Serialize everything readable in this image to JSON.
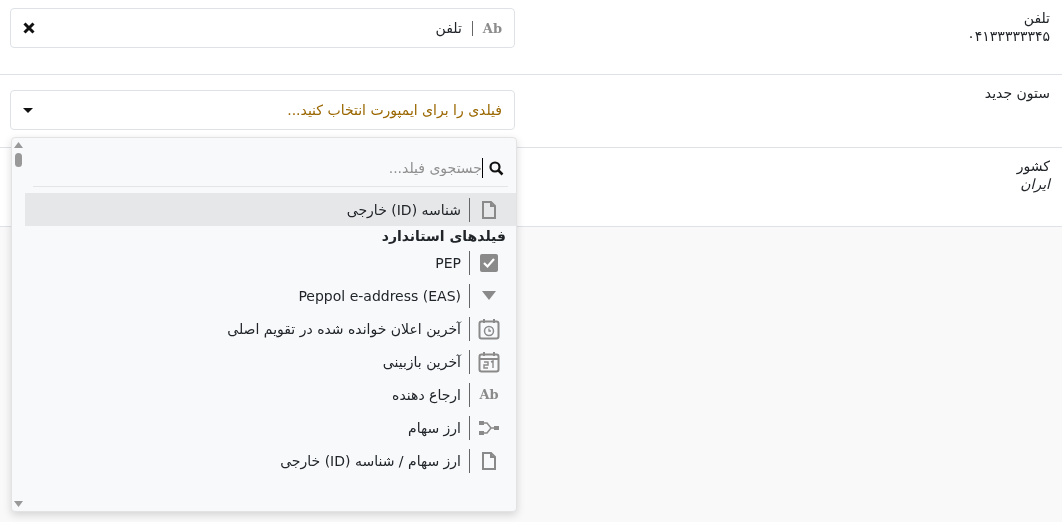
{
  "rows": [
    {
      "label": "تلفن",
      "value": "۰۴۱۳۳۳۳۳۳۴۵",
      "value_italic": false,
      "field": {
        "kind": "chosen",
        "text": "تلفن",
        "type_badge": "Ab"
      }
    },
    {
      "label": "ستون جدید",
      "field": {
        "kind": "empty",
        "placeholder": "فیلدی را برای ایمپورت انتخاب کنید..."
      },
      "dropdown": {
        "search_placeholder": "جستجوی فیلد...",
        "items": [
          {
            "kind": "document",
            "label": "شناسه (ID) خارجی",
            "selected": true
          },
          {
            "kind": "header",
            "label": "فیلدهای استاندارد"
          },
          {
            "kind": "checkbox",
            "label": "PEP",
            "selected": false
          },
          {
            "kind": "selection",
            "label": "Peppol e-address (EAS)",
            "selected": false
          },
          {
            "kind": "datetime",
            "label": "آخرین اعلان خوانده شده در تقویم اصلی",
            "selected": false
          },
          {
            "kind": "date",
            "label": "آخرین بازبینی",
            "selected": false
          },
          {
            "kind": "text",
            "type_badge": "Ab",
            "label": "ارجاع دهنده",
            "selected": false
          },
          {
            "kind": "relation",
            "label": "ارز سهام",
            "selected": false
          },
          {
            "kind": "document",
            "label": "ارز سهام / شناسه (ID) خارجی",
            "selected": false
          }
        ]
      }
    },
    {
      "label": "کشور",
      "value": "ایران",
      "value_italic": true
    }
  ]
}
